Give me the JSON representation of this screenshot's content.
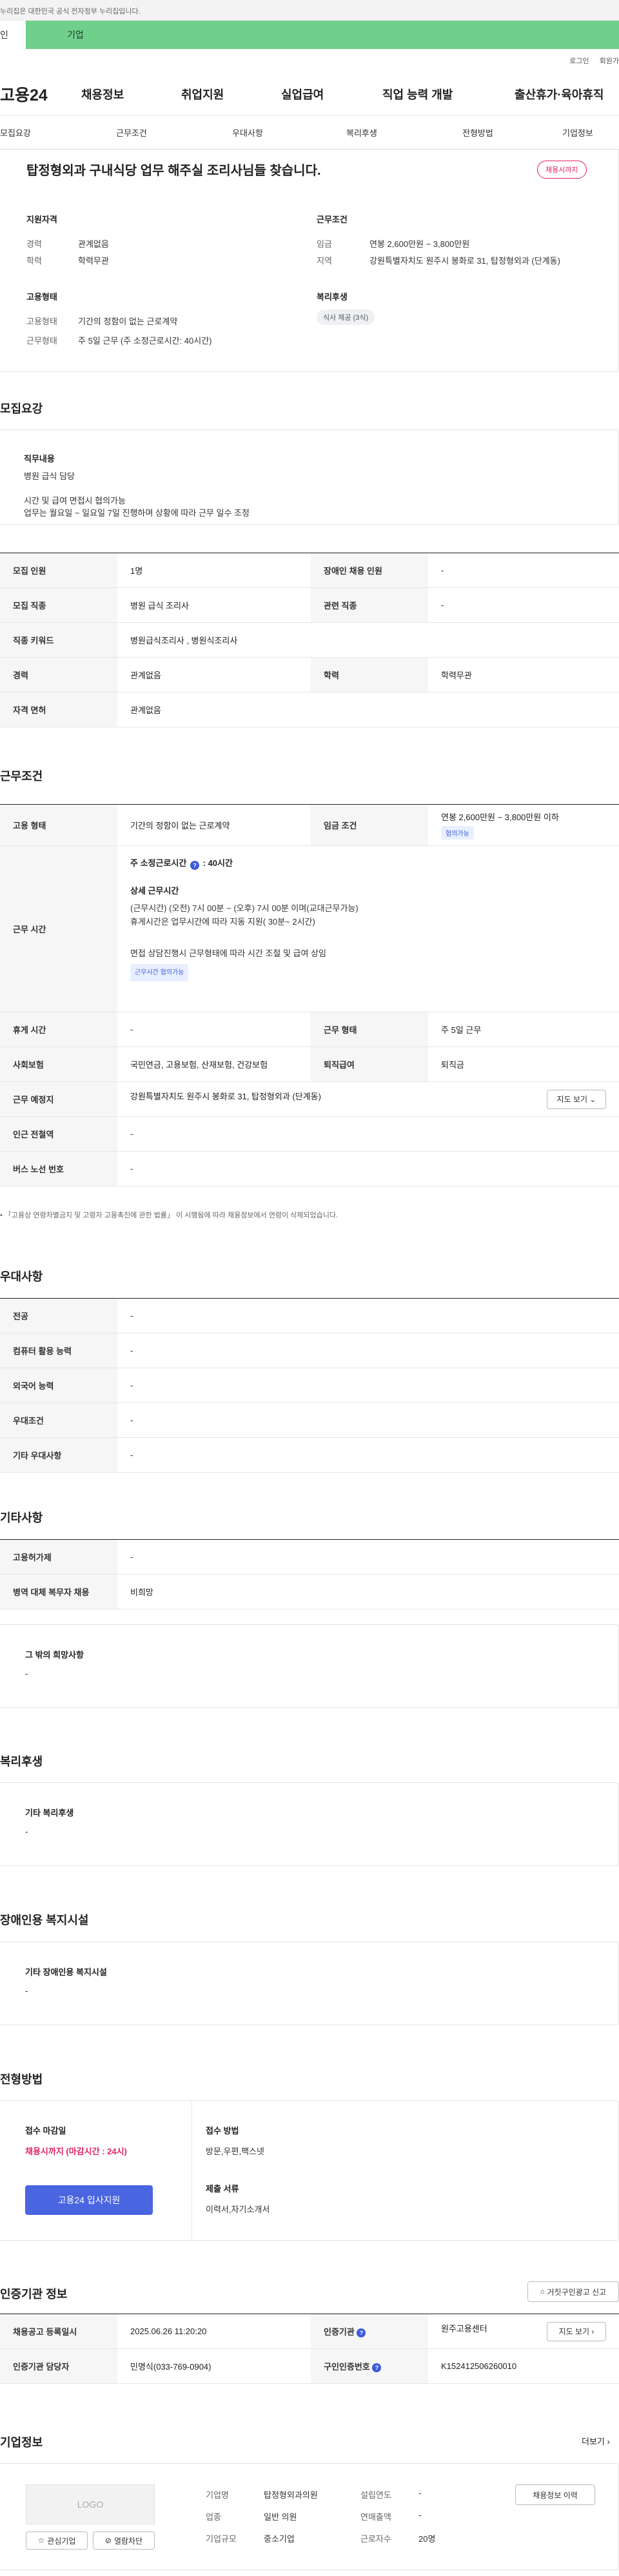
{
  "gov_notice": "이 누리집은 대한민국 공식 전자정부 누리집입니다.",
  "gov_notice_visible": "누리집은 대한민국 공식 전자정부 누리집입니다.",
  "site_tabs": [
    "인",
    "기업"
  ],
  "util": [
    "로그인",
    "회원가"
  ],
  "logo": "고용24",
  "gnb": [
    "채용정보",
    "취업지원",
    "실업급여",
    "직업 능력 개발",
    "출산휴가·육아휴직"
  ],
  "subnav": [
    "모집요강",
    "근무조건",
    "우대사항",
    "복리후생",
    "전형방법",
    "기업정보"
  ],
  "summary": {
    "title": "탑정형외과 구내식당 업무 해주실 조리사님들 찾습니다.",
    "deadline_badge": "채용시까지",
    "qual_title": "지원자격",
    "qual": [
      {
        "k": "경력",
        "v": "관계없음"
      },
      {
        "k": "학력",
        "v": "학력무관"
      }
    ],
    "cond_title": "근무조건",
    "cond": [
      {
        "k": "임금",
        "v": "연봉 2,600만원 ~ 3,800만원"
      },
      {
        "k": "지역",
        "v": "강원특별자치도 원주시 봉화로 31, 탑정형외과 (단계동)"
      }
    ],
    "emp_title": "고용형태",
    "emp": [
      {
        "k": "고용형태",
        "v": "기간의 정함이 없는 근로계약"
      },
      {
        "k": "근무형태",
        "v": "주 5일 근무 (주 소정근로시간: 40시간)"
      }
    ],
    "welfare_title": "복리후생",
    "welfare_pill": "식사 제공 (3식)"
  },
  "recruit": {
    "heading": "모집요강",
    "duty_title": "직무내용",
    "duty_lines": [
      "병원 급식 담당",
      "",
      "시간 및 급여 면접시 협의가능",
      "업무는 월요일 ~ 일요일 7일 진행하며 상황에 따라 근무 일수 조정"
    ],
    "rows": [
      {
        "k1": "모집 인원",
        "v1": "1명",
        "k2": "장애인 채용 인원",
        "v2": "-"
      },
      {
        "k1": "모집 직종",
        "v1": "병원 급식 조리사",
        "k2": "관련 직종",
        "v2": "-"
      },
      {
        "k1": "직종 키워드",
        "v1": "병원급식조리사 , 병원식조리사"
      },
      {
        "k1": "경력",
        "v1": "관계없음",
        "k2": "학력",
        "v2": "학력무관"
      },
      {
        "k1": "자격 면허",
        "v1": "관계없음"
      }
    ]
  },
  "work": {
    "heading": "근무조건",
    "emp_label": "고용 형태",
    "emp_value": "기간의 정함이 없는 근로계약",
    "wage_label": "임금 조건",
    "wage_value": "연봉 2,600만원 ~ 3,800만원 이하",
    "wage_badge": "협의가능",
    "time_label": "근무 시간",
    "time_main": "주 소정근로시간",
    "time_hours": ": 40시간",
    "time_detail_title": "상세 근무시간",
    "time_detail_lines": [
      "(근무시간) (오전) 7시 00분 ~ (오후) 7시 00분 이며(교대근무가능)",
      "휴게시간은 업무시간에 따라 지동 지원( 30분~ 2시간)",
      "",
      "면접 상담진행시 근무형태에 따라 시간 조절 및 급여 상임"
    ],
    "time_badge": "근무시간 협의가능",
    "rows": [
      {
        "k1": "휴게 시간",
        "v1": "-",
        "k2": "근무 형태",
        "v2": "주 5일 근무"
      },
      {
        "k1": "사회보험",
        "v1": "국민연금, 고용보험, 산재보험, 건강보험",
        "k2": "퇴직급여",
        "v2": "퇴직금"
      },
      {
        "k1": "근무 예정지",
        "v1": "강원특별자치도 원주시 봉화로 31, 탑정형외과 (단계동)",
        "btn": "지도 보기"
      },
      {
        "k1": "인근 전철역",
        "v1": "-"
      },
      {
        "k1": "버스 노선 번호",
        "v1": "-"
      }
    ],
    "footnote": "「고용상 연령차별금지 및 고령자 고용촉진에 관한 법률」 이 시행됨에 따라 채용정보에서 연령이 삭제되었습니다."
  },
  "pref": {
    "heading": "우대사항",
    "rows": [
      {
        "k": "전공",
        "v": "-"
      },
      {
        "k": "컴퓨터 활용 능력",
        "v": "-"
      },
      {
        "k": "외국어 능력",
        "v": "-"
      },
      {
        "k": "우대조건",
        "v": "-"
      },
      {
        "k": "기타 우대사항",
        "v": "-"
      }
    ]
  },
  "etc": {
    "heading": "기타사항",
    "rows": [
      {
        "k": "고용허가제",
        "v": "-"
      },
      {
        "k": "병역 대체 복무자 채용",
        "v": "비희망"
      }
    ],
    "box_title": "그 밖의 희망사항",
    "box_value": "-"
  },
  "welfare": {
    "heading": "복리후생",
    "box_title": "기타 복리후생",
    "box_value": "-"
  },
  "disab": {
    "heading": "장애인용 복지시설",
    "box_title": "기타 장애인용 복지시설",
    "box_value": "-"
  },
  "process": {
    "heading": "전형방법",
    "deadline_title": "접수 마감일",
    "deadline_value": "채용시까지 (마감시간 : 24시)",
    "apply_btn": "고용24 입사지원",
    "method_title": "접수 방법",
    "method_value": "방문,우편,팩스넷",
    "docs_title": "제출 서류",
    "docs_value": "이력서,자기소개서"
  },
  "agency": {
    "heading": "인증기관 정보",
    "report_btn": "거짓구인광고 신고",
    "rows": [
      {
        "k1": "채용공고 등록일시",
        "v1": "2025.06.26 11:20:20",
        "k2": "인증기관",
        "v2": "원주고용센터",
        "btn": "지도 보기"
      },
      {
        "k1": "인증기관 담당자",
        "v1": "민명식(033-769-0904)",
        "k2": "구인인증번호",
        "v2": "K152412506260010"
      }
    ]
  },
  "company": {
    "heading": "기업정보",
    "more": "더보기",
    "logo": "LOGO",
    "fav_btn": "관심기업",
    "block_btn": "열람차단",
    "history_btn": "채용정보 이력",
    "fields": [
      {
        "k": "기업명",
        "v": "탑정형외과의원"
      },
      {
        "k": "설립연도",
        "v": "-"
      },
      {
        "k": "업종",
        "v": "일반 의원"
      },
      {
        "k": "연매출액",
        "v": "-"
      },
      {
        "k": "기업규모",
        "v": "중소기업"
      },
      {
        "k": "근로자수",
        "v": "20명"
      }
    ]
  },
  "colors": {
    "accent": "#4a65e0",
    "green": "#6fcf8b",
    "red": "#e0245e"
  }
}
